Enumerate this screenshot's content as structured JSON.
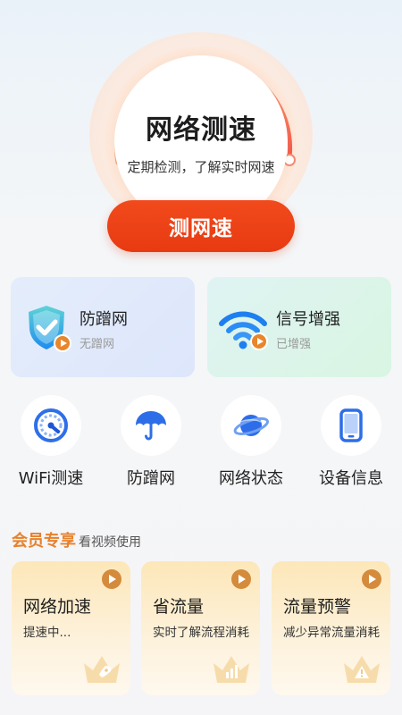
{
  "speed_test": {
    "title": "网络测速",
    "subtitle": "定期检测，了解实时网速",
    "button_label": "测网速"
  },
  "feature_cards": [
    {
      "title": "防蹭网",
      "status": "无蹭网",
      "icon": "shield-icon"
    },
    {
      "title": "信号增强",
      "status": "已增强",
      "icon": "wifi-icon"
    }
  ],
  "tools": [
    {
      "label": "WiFi测速",
      "icon": "speedometer-icon"
    },
    {
      "label": "防蹭网",
      "icon": "umbrella-icon"
    },
    {
      "label": "网络状态",
      "icon": "planet-icon"
    },
    {
      "label": "设备信息",
      "icon": "phone-icon"
    }
  ],
  "member": {
    "title": "会员专享",
    "subtitle": "看视频使用",
    "cards": [
      {
        "title": "网络加速",
        "desc": "提速中...",
        "icon": "rocket-crown-icon"
      },
      {
        "title": "省流量",
        "desc": "实时了解流程消耗",
        "icon": "bars-crown-icon"
      },
      {
        "title": "流量预警",
        "desc": "减少异常流量消耗",
        "icon": "warning-crown-icon"
      }
    ]
  },
  "colors": {
    "accent_red": "#e83a12",
    "member_orange": "#e7812c",
    "play_orange": "#e8862c"
  }
}
